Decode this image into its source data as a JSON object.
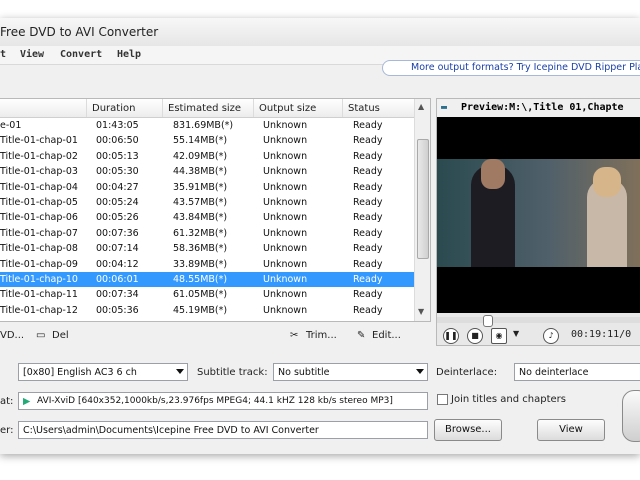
{
  "window": {
    "title": "Free DVD to AVI Converter"
  },
  "menu": [
    "t",
    "View",
    "Convert",
    "Help"
  ],
  "promo": {
    "text": "More output formats? Try Icepine DVD Ripper Plati"
  },
  "table": {
    "columns": [
      "Duration",
      "Estimated size",
      "Output size",
      "Status"
    ],
    "rows": [
      {
        "name": "e-01",
        "duration": "01:43:05",
        "est": "831.69MB(*)",
        "out": "Unknown",
        "status": "Ready"
      },
      {
        "name": "Title-01-chap-01",
        "duration": "00:06:50",
        "est": "55.14MB(*)",
        "out": "Unknown",
        "status": "Ready"
      },
      {
        "name": "Title-01-chap-02",
        "duration": "00:05:13",
        "est": "42.09MB(*)",
        "out": "Unknown",
        "status": "Ready"
      },
      {
        "name": "Title-01-chap-03",
        "duration": "00:05:30",
        "est": "44.38MB(*)",
        "out": "Unknown",
        "status": "Ready"
      },
      {
        "name": "Title-01-chap-04",
        "duration": "00:04:27",
        "est": "35.91MB(*)",
        "out": "Unknown",
        "status": "Ready"
      },
      {
        "name": "Title-01-chap-05",
        "duration": "00:05:24",
        "est": "43.57MB(*)",
        "out": "Unknown",
        "status": "Ready"
      },
      {
        "name": "Title-01-chap-06",
        "duration": "00:05:26",
        "est": "43.84MB(*)",
        "out": "Unknown",
        "status": "Ready"
      },
      {
        "name": "Title-01-chap-07",
        "duration": "00:07:36",
        "est": "61.32MB(*)",
        "out": "Unknown",
        "status": "Ready"
      },
      {
        "name": "Title-01-chap-08",
        "duration": "00:07:14",
        "est": "58.36MB(*)",
        "out": "Unknown",
        "status": "Ready"
      },
      {
        "name": "Title-01-chap-09",
        "duration": "00:04:12",
        "est": "33.89MB(*)",
        "out": "Unknown",
        "status": "Ready"
      },
      {
        "name": "Title-01-chap-10",
        "duration": "00:06:01",
        "est": "48.55MB(*)",
        "out": "Unknown",
        "status": "Ready",
        "selected": true
      },
      {
        "name": "Title-01-chap-11",
        "duration": "00:07:34",
        "est": "61.05MB(*)",
        "out": "Unknown",
        "status": "Ready"
      },
      {
        "name": "Title-01-chap-12",
        "duration": "00:05:36",
        "est": "45.19MB(*)",
        "out": "Unknown",
        "status": "Ready"
      }
    ]
  },
  "toolbar": {
    "dvd": "VD...",
    "del": "Del",
    "trim": "Trim...",
    "edit": "Edit..."
  },
  "preview": {
    "title": "Preview:M:\\,Title 01,Chapte",
    "time": "00:19:11/0"
  },
  "audio": {
    "value": "[0x80] English AC3 6 ch"
  },
  "subtitle": {
    "label": "Subtitle track:",
    "value": "No subtitle"
  },
  "deinterlace": {
    "label": "Deinterlace:",
    "value": "No deinterlace"
  },
  "format": {
    "label": "at:",
    "value": "AVI-XviD [640x352,1000kb/s,23.976fps MPEG4;  44.1 kHZ 128 kb/s stereo MP3]"
  },
  "join": {
    "label": "Join titles and chapters"
  },
  "output": {
    "label": "er:",
    "value": "C:\\Users\\admin\\Documents\\Icepine Free DVD to AVI Converter"
  },
  "buttons": {
    "browse": "Browse...",
    "view": "View"
  },
  "colors": {
    "selection": "#3399ff",
    "link": "#1a3fa8"
  }
}
